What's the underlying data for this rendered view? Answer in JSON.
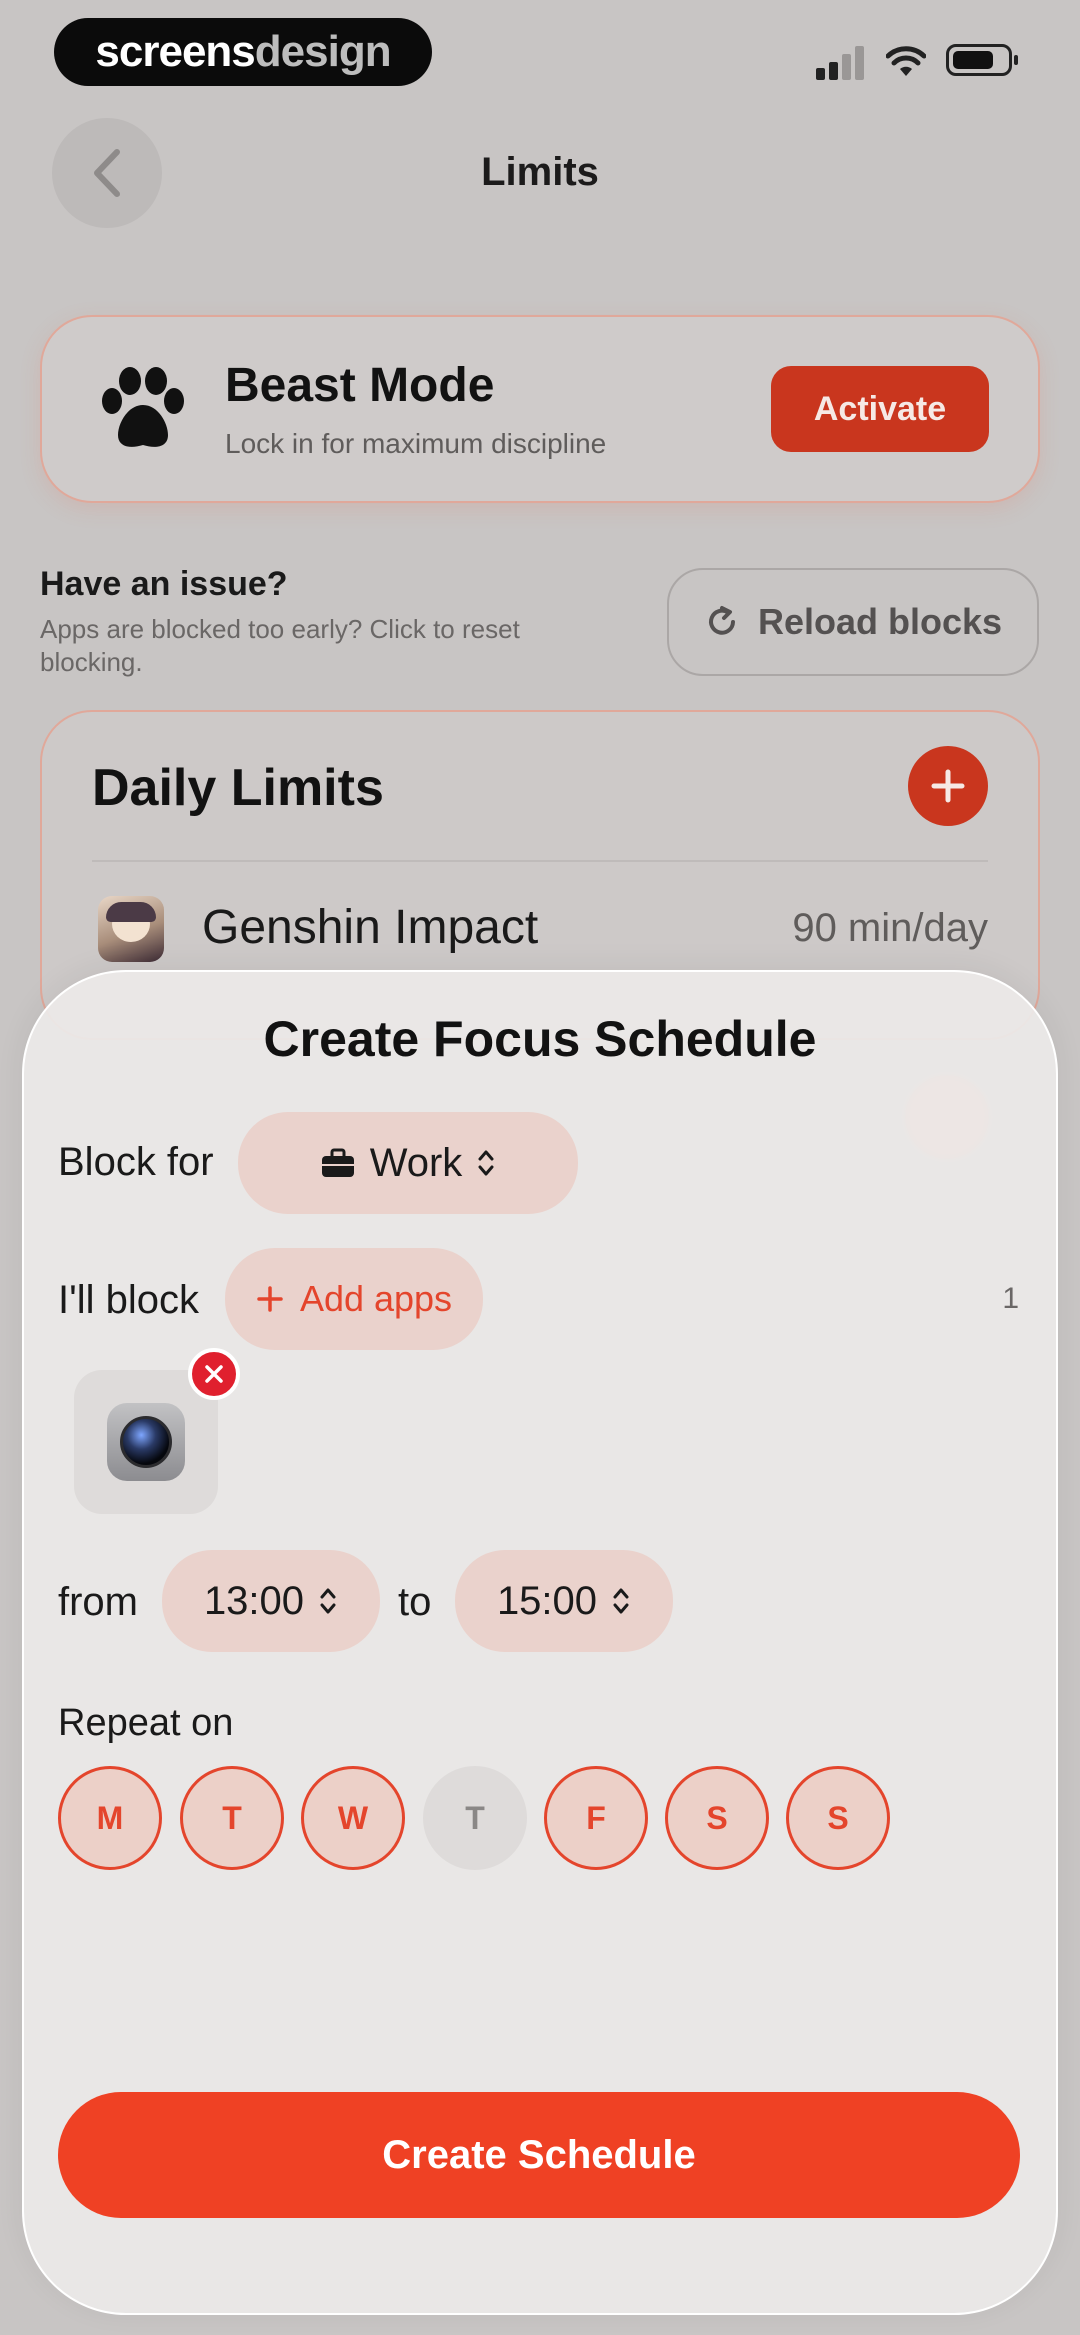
{
  "brand": {
    "text_bold": "screens",
    "text_light": "design"
  },
  "header": {
    "title": "Limits"
  },
  "beast_mode": {
    "title": "Beast Mode",
    "subtitle": "Lock in for maximum discipline",
    "activate_label": "Activate"
  },
  "issue": {
    "title": "Have an issue?",
    "subtitle": "Apps are blocked too early? Click to reset blocking.",
    "reload_label": "Reload blocks"
  },
  "daily_limits": {
    "title": "Daily Limits",
    "items": [
      {
        "name": "Genshin Impact",
        "limit": "90 min/day",
        "icon": "genshin-impact-app-icon"
      }
    ]
  },
  "sheet": {
    "title": "Create Focus Schedule",
    "block_for_label": "Block for",
    "block_for_value": "Work",
    "block_for_icon": "briefcase-icon",
    "ill_block_label": "I'll block",
    "add_apps_label": "Add apps",
    "selected_count": "1",
    "selected_apps": [
      {
        "icon": "camera-app-icon"
      }
    ],
    "from_label": "from",
    "from_value": "13:00",
    "to_label": "to",
    "to_value": "15:00",
    "repeat_label": "Repeat on",
    "days": [
      {
        "label": "M",
        "selected": true
      },
      {
        "label": "T",
        "selected": true
      },
      {
        "label": "W",
        "selected": true
      },
      {
        "label": "T",
        "selected": false
      },
      {
        "label": "F",
        "selected": true
      },
      {
        "label": "S",
        "selected": true
      },
      {
        "label": "S",
        "selected": true
      }
    ],
    "create_label": "Create Schedule"
  },
  "colors": {
    "accent": "#ef4124",
    "accent_dark": "#c9361e",
    "pill_bg": "#ead2cc",
    "remove_red": "#e0202e"
  }
}
